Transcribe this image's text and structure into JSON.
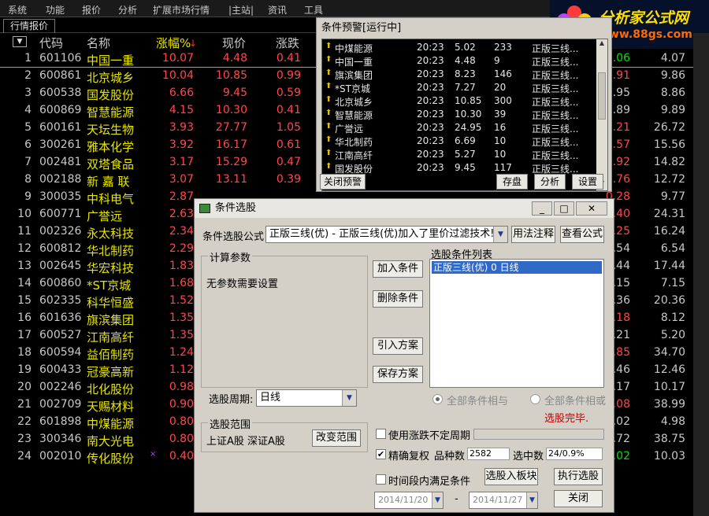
{
  "menu": [
    "系统",
    "功能",
    "报价",
    "分析",
    "扩展市场行情",
    "|主站|",
    "资讯",
    "工具"
  ],
  "logo": {
    "title": "分析家公式网",
    "url": "www.88gs.com"
  },
  "tab": "行情报价",
  "headers": {
    "code": "代码",
    "name": "名称",
    "pct": "涨幅%",
    "price": "现价",
    "chg": "涨跌",
    "pe": "市盈"
  },
  "rows": [
    {
      "no": "1",
      "code": "601106",
      "name": "中国一重",
      "pct": "10.07",
      "price": "4.48",
      "chg": "0.41",
      "rv": "1.06",
      "rvc": "g",
      "pe": "4.07"
    },
    {
      "no": "2",
      "code": "600861",
      "name": "北京城乡",
      "pct": "10.04",
      "price": "10.85",
      "chg": "0.99",
      "rv": "0.91",
      "rvc": "r",
      "pe": "9.86"
    },
    {
      "no": "3",
      "code": "600538",
      "name": "国发股份",
      "pct": "6.66",
      "price": "9.45",
      "chg": "0.59",
      "rv": "0.95",
      "rvc": "",
      "pe": "8.86"
    },
    {
      "no": "4",
      "code": "600869",
      "name": "智慧能源",
      "pct": "4.15",
      "price": "10.30",
      "chg": "0.41",
      "rv": "0.89",
      "rvc": "",
      "pe": "9.89"
    },
    {
      "no": "5",
      "code": "600161",
      "name": "天坛生物",
      "pct": "3.93",
      "price": "27.77",
      "chg": "1.05",
      "rv": "7.21",
      "rvc": "r",
      "pe": "26.72"
    },
    {
      "no": "6",
      "code": "300261",
      "name": "雅本化学",
      "pct": "3.92",
      "price": "16.17",
      "chg": "0.61",
      "rv": "5.57",
      "rvc": "r",
      "pe": "15.56"
    },
    {
      "no": "7",
      "code": "002481",
      "name": "双塔食品",
      "pct": "3.17",
      "price": "15.29",
      "chg": "0.47",
      "rv": "4.92",
      "rvc": "r",
      "pe": "14.82"
    },
    {
      "no": "8",
      "code": "002188",
      "name": "新 嘉 联",
      "pct": "3.07",
      "price": "13.11",
      "chg": "0.39",
      "rv": "2.76",
      "rvc": "r",
      "pe": "12.72"
    },
    {
      "no": "9",
      "code": "300035",
      "name": "中科电气",
      "pct": "2.87",
      "price": "",
      "chg": "",
      "rv": "0.28",
      "rvc": "r",
      "pe": "9.77"
    },
    {
      "no": "10",
      "code": "600771",
      "name": "广誉远",
      "pct": "2.63",
      "price": "",
      "chg": "",
      "rv": "1.40",
      "rvc": "r",
      "pe": "24.31"
    },
    {
      "no": "11",
      "code": "002326",
      "name": "永太科技",
      "pct": "2.34",
      "price": "",
      "chg": "",
      "rv": "1.25",
      "rvc": "r",
      "pe": "16.24"
    },
    {
      "no": "12",
      "code": "600812",
      "name": "华北制药",
      "pct": "2.29",
      "price": "",
      "chg": "",
      "rv": "0.54",
      "rvc": "",
      "pe": "6.54"
    },
    {
      "no": "13",
      "code": "002645",
      "name": "华宏科技",
      "pct": "1.83",
      "price": "",
      "chg": "",
      "rv": "1.44",
      "rvc": "",
      "pe": "17.44"
    },
    {
      "no": "14",
      "code": "600860",
      "name": "*ST京城",
      "pct": "1.68",
      "price": "",
      "chg": "",
      "rv": "0.15",
      "rvc": "",
      "pe": "7.15"
    },
    {
      "no": "15",
      "code": "602335",
      "name": "科华恒盛",
      "pct": "1.52",
      "price": "",
      "chg": "",
      "rv": "0.36",
      "rvc": "",
      "pe": "20.36"
    },
    {
      "no": "16",
      "code": "601636",
      "name": "旗滨集团",
      "pct": "1.35",
      "price": "",
      "chg": "",
      "rv": "0.18",
      "rvc": "r",
      "pe": "8.12"
    },
    {
      "no": "17",
      "code": "600527",
      "name": "江南高纤",
      "pct": "1.35",
      "price": "",
      "chg": "",
      "rv": "0.21",
      "rvc": "",
      "pe": "5.20"
    },
    {
      "no": "18",
      "code": "600594",
      "name": "益佰制药",
      "pct": "1.24",
      "price": "",
      "chg": "",
      "rv": "0.85",
      "rvc": "r",
      "pe": "34.70"
    },
    {
      "no": "19",
      "code": "600433",
      "name": "冠豪高新",
      "pct": "1.12",
      "price": "",
      "chg": "",
      "rv": "0.46",
      "rvc": "",
      "pe": "12.46"
    },
    {
      "no": "20",
      "code": "002246",
      "name": "北化股份",
      "pct": "0.98",
      "price": "",
      "chg": "",
      "rv": "0.17",
      "rvc": "",
      "pe": "10.17"
    },
    {
      "no": "21",
      "code": "002709",
      "name": "天赐材料",
      "pct": "0.90",
      "price": "",
      "chg": "",
      "rv": "0.08",
      "rvc": "r",
      "pe": "38.99"
    },
    {
      "no": "22",
      "code": "601898",
      "name": "中煤能源",
      "pct": "0.80",
      "price": "",
      "chg": "",
      "rv": "0.02",
      "rvc": "",
      "pe": "4.98"
    },
    {
      "no": "23",
      "code": "300346",
      "name": "南大光电",
      "pct": "0.80",
      "price": "",
      "chg": "",
      "rv": "0.72",
      "rvc": "",
      "pe": "38.75"
    },
    {
      "no": "24",
      "code": "002010",
      "name": "传化股份",
      "pct": "0.40",
      "price": "",
      "chg": "",
      "rv": "0.02",
      "rvc": "g",
      "pe": "10.03"
    }
  ],
  "alert": {
    "title": "条件预警[运行中]",
    "rows": [
      {
        "n": "中煤能源",
        "t": "20:23",
        "p": "5.02",
        "v": "233",
        "f": "正版三线..."
      },
      {
        "n": "中国一重",
        "t": "20:23",
        "p": "4.48",
        "v": "9",
        "f": "正版三线..."
      },
      {
        "n": "旗滨集团",
        "t": "20:23",
        "p": "8.23",
        "v": "146",
        "f": "正版三线..."
      },
      {
        "n": "*ST京城",
        "t": "20:23",
        "p": "7.27",
        "v": "20",
        "f": "正版三线..."
      },
      {
        "n": "北京城乡",
        "t": "20:23",
        "p": "10.85",
        "v": "300",
        "f": "正版三线..."
      },
      {
        "n": "智慧能源",
        "t": "20:23",
        "p": "10.30",
        "v": "39",
        "f": "正版三线..."
      },
      {
        "n": "广誉远",
        "t": "20:23",
        "p": "24.95",
        "v": "16",
        "f": "正版三线..."
      },
      {
        "n": "华北制药",
        "t": "20:23",
        "p": "6.69",
        "v": "10",
        "f": "正版三线..."
      },
      {
        "n": "江南高纤",
        "t": "20:23",
        "p": "5.27",
        "v": "10",
        "f": "正版三线..."
      },
      {
        "n": "国发股份",
        "t": "20:23",
        "p": "9.45",
        "v": "117",
        "f": "正版三线..."
      }
    ],
    "btn_close": "关闭预警",
    "btn_save": "存盘",
    "btn_analyze": "分析",
    "btn_settings": "设置"
  },
  "dialog": {
    "title": "条件选股",
    "formula_label": "条件选股公式",
    "formula_value": "正版三线(优) - 正版三线(优)加入了里价过滤技术!",
    "usage_btn": "用法注释",
    "view_btn": "查看公式",
    "params_group": "计算参数",
    "params_text": "无参数需要设置",
    "add_cond": "加入条件",
    "del_cond": "删除条件",
    "import_plan": "引入方案",
    "save_plan": "保存方案",
    "cond_list_label": "选股条件列表",
    "cond_item": "正版三线(优)  0  日线",
    "period_label": "选股周期:",
    "period_value": "日线",
    "radio_and": "全部条件相与",
    "radio_or": "全部条件相或",
    "status": "选股完毕.",
    "range_group": "选股范围",
    "range_text": "上证A股  深证A股",
    "change_range": "改变范围",
    "chk_period": "使用涨跌不定周期",
    "chk_adjust": "精确复权",
    "count_label": "品种数",
    "count_value": "2582",
    "selected_label": "选中数",
    "selected_value": "24/0.9%",
    "chk_time": "时间段内满足条件",
    "to_block": "选股入板块",
    "execute": "执行选股",
    "date_from": "2014/11/20",
    "date_sep": "-",
    "date_to": "2014/11/27",
    "close": "关闭"
  }
}
